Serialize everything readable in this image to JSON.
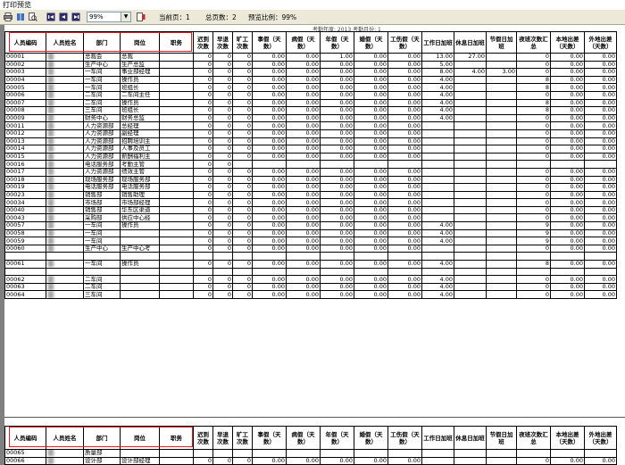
{
  "window": {
    "title": "打印预览"
  },
  "toolbar": {
    "zoom_value": "99%",
    "current_page_label": "当前页：1",
    "total_pages_label": "总页数：2",
    "preview_ratio_label": "预览比例：99%"
  },
  "report": {
    "top_strip": "考勤年度: 2013        考勤月份: 1",
    "headers": [
      "人员编码",
      "人员姓名",
      "部门",
      "岗位",
      "职务",
      "迟到次数",
      "早退次数",
      "旷工次数",
      "事假（天数）",
      "病假（天数）",
      "年假（天数）",
      "婚假（天数）",
      "工伤假（天数）",
      "工作日加班",
      "休息日加班",
      "节假日加班",
      "夜班次数汇总",
      "本地出差（天数）",
      "外地出差（天数）"
    ],
    "rows": [
      [
        "00001",
        "",
        "总裁会",
        "总裁",
        "",
        "0",
        "0",
        "0",
        "0.00",
        "0.00",
        "1.00",
        "0.00",
        "0.00",
        "13.00",
        "27.00",
        "",
        "0",
        "0.00",
        "0.00"
      ],
      [
        "00002",
        "",
        "生产中心",
        "生产总监",
        "",
        "0",
        "0",
        "0",
        "0.00",
        "0.00",
        "0.00",
        "0.00",
        "0.00",
        "5.00",
        "",
        "",
        "0",
        "0.00",
        "0.00"
      ],
      [
        "00003",
        "",
        "一车间",
        "事业部经理",
        "",
        "0",
        "0",
        "0",
        "0.00",
        "0.00",
        "0.00",
        "0.00",
        "0.00",
        "8.00",
        "4.00",
        "3.00",
        "0",
        "0.00",
        "0.00"
      ],
      [
        "00004",
        "",
        "一车间",
        "操作员",
        "",
        "0",
        "0",
        "0",
        "0.00",
        "0.00",
        "0.00",
        "0.00",
        "0.00",
        "4.00",
        "",
        "",
        "8",
        "0.00",
        "0.00"
      ],
      [
        "00005",
        "",
        "一车间",
        "班组长",
        "",
        "0",
        "0",
        "0",
        "0.00",
        "0.00",
        "0.00",
        "0.00",
        "0.00",
        "4.00",
        "",
        "",
        "8",
        "0.00",
        "0.00"
      ],
      [
        "00006",
        "",
        "二车间",
        "二车间主任",
        "",
        "0",
        "0",
        "0",
        "0.00",
        "0.00",
        "0.00",
        "0.00",
        "0.00",
        "4.00",
        "",
        "",
        "0",
        "0.00",
        "0.00"
      ],
      [
        "00007",
        "",
        "二车间",
        "操作员",
        "",
        "0",
        "0",
        "0",
        "0.00",
        "0.00",
        "0.00",
        "0.00",
        "0.00",
        "4.00",
        "",
        "",
        "8",
        "0.00",
        "0.00"
      ],
      [
        "00008",
        "",
        "三车间",
        "班组长",
        "",
        "0",
        "0",
        "0",
        "0.00",
        "0.00",
        "0.00",
        "0.00",
        "0.00",
        "4.00",
        "",
        "",
        "8",
        "0.00",
        "0.00"
      ],
      [
        "00009",
        "",
        "财务中心",
        "财务总监",
        "",
        "0",
        "0",
        "0",
        "0.00",
        "0.00",
        "0.00",
        "0.00",
        "0.00",
        "4.00",
        "",
        "",
        "0",
        "0.00",
        "0.00"
      ],
      [
        "00011",
        "",
        "人力资源部",
        "总经理",
        "",
        "0",
        "0",
        "0",
        "0.00",
        "0.00",
        "0.00",
        "0.00",
        "0.00",
        "",
        "",
        "",
        "0",
        "0.00",
        "0.00"
      ],
      [
        "00012",
        "",
        "人力资源部",
        "副经理",
        "",
        "0",
        "0",
        "0",
        "0.00",
        "0.00",
        "0.00",
        "0.00",
        "0.00",
        "",
        "",
        "",
        "0",
        "0.00",
        "0.00"
      ],
      [
        "00013",
        "",
        "人力资源部",
        "招聘培训主",
        "",
        "0",
        "0",
        "0",
        "0.00",
        "0.00",
        "0.00",
        "0.00",
        "0.00",
        "",
        "",
        "",
        "0",
        "0.00",
        "0.00"
      ],
      [
        "00014",
        "",
        "人力资源部",
        "人事及员工",
        "",
        "0",
        "0",
        "0",
        "0.00",
        "0.00",
        "0.00",
        "0.00",
        "0.00",
        "",
        "",
        "",
        "0",
        "0.00",
        "0.00"
      ],
      [
        "00015",
        "",
        "人力资源部",
        "薪酬福利主",
        "",
        "0",
        "0",
        "0",
        "0.00",
        "0.00",
        "0.00",
        "0.00",
        "0.00",
        "",
        "",
        "",
        "0",
        "0.00",
        "0.00"
      ],
      [
        "00016",
        "",
        "电话服务部",
        "考勤主管",
        "",
        "0",
        "0",
        "",
        "",
        "",
        "",
        "",
        "",
        "",
        "",
        "",
        "",
        "",
        ""
      ],
      [
        "00017",
        "",
        "人力资源部",
        "绩效主管",
        "",
        "0",
        "0",
        "0",
        "0.00",
        "0.00",
        "0.00",
        "0.00",
        "0.00",
        "",
        "",
        "",
        "0",
        "0.00",
        "0.00"
      ],
      [
        "00018",
        "",
        "现场服务部",
        "现场服务部",
        "",
        "0",
        "0",
        "0",
        "0.00",
        "0.00",
        "0.00",
        "0.00",
        "0.00",
        "",
        "",
        "",
        "0",
        "0.00",
        "0.00"
      ],
      [
        "00019",
        "",
        "电话服务部",
        "电话服务部",
        "",
        "0",
        "0",
        "0",
        "0.00",
        "0.00",
        "0.00",
        "0.00",
        "0.00",
        "",
        "",
        "",
        "0",
        "0.00",
        "0.00"
      ],
      [
        "00023",
        "",
        "销售部",
        "销售助理",
        "",
        "0",
        "0",
        "0",
        "0.00",
        "0.00",
        "0.00",
        "0.00",
        "0.00",
        "",
        "",
        "",
        "0",
        "0.00",
        "0.00"
      ],
      [
        "00034",
        "",
        "市场部",
        "市场部经理",
        "",
        "0",
        "0",
        "0",
        "0.00",
        "0.00",
        "0.00",
        "0.00",
        "0.00",
        "",
        "",
        "",
        "0",
        "0.00",
        "0.00"
      ],
      [
        "00040",
        "",
        "销售部",
        "华东区渠道",
        "",
        "0",
        "0",
        "0",
        "0.00",
        "0.00",
        "0.00",
        "0.00",
        "0.00",
        "",
        "",
        "",
        "0",
        "0.00",
        "0.00"
      ],
      [
        "00043",
        "",
        "采购部",
        "供应中心经",
        "",
        "0",
        "0",
        "0",
        "0.00",
        "0.00",
        "0.00",
        "0.00",
        "0.00",
        "",
        "",
        "",
        "0",
        "0.00",
        "0.00"
      ],
      [
        "00057",
        "",
        "一车间",
        "操作员",
        "",
        "0",
        "0",
        "0",
        "0.00",
        "0.00",
        "0.00",
        "0.00",
        "0.00",
        "4.00",
        "",
        "",
        "9",
        "0.00",
        "0.00"
      ],
      [
        "00058",
        "",
        "一车间",
        "",
        "",
        "0",
        "0",
        "0",
        "0.00",
        "0.00",
        "0.00",
        "0.00",
        "0.00",
        "4.00",
        "",
        "",
        "9",
        "0.00",
        "0.00"
      ],
      [
        "00059",
        "",
        "一车间",
        "",
        "",
        "0",
        "0",
        "0",
        "0.00",
        "0.00",
        "0.00",
        "0.00",
        "0.00",
        "4.00",
        "",
        "",
        "9",
        "0.00",
        "0.00"
      ],
      [
        "00060",
        "",
        "生产中心",
        "生产中心考",
        "",
        "0",
        "0",
        "0",
        "0.00",
        "0.00",
        "0.00",
        "0.00",
        "0.00",
        "",
        "",
        "",
        "0",
        "0.00",
        "0.00"
      ],
      [
        "",
        "",
        "",
        "",
        "",
        "",
        "",
        "",
        "",
        "",
        "",
        "",
        "",
        "",
        "",
        "",
        "",
        "",
        ""
      ],
      [
        "00061",
        "",
        "一车间",
        "操作员",
        "",
        "0",
        "0",
        "0",
        "0.00",
        "0.00",
        "0.00",
        "0.00",
        "0.00",
        "4.00",
        "",
        "",
        "8",
        "0.00",
        "0.00"
      ],
      [
        "",
        "",
        "",
        "",
        "",
        "",
        "",
        "",
        "",
        "",
        "",
        "",
        "",
        "",
        "",
        "",
        "",
        "",
        ""
      ],
      [
        "00062",
        "",
        "二车间",
        "",
        "",
        "0",
        "0",
        "0",
        "0.00",
        "0.00",
        "0.00",
        "0.00",
        "0.00",
        "4.00",
        "",
        "",
        "0",
        "0.00",
        "0.00"
      ],
      [
        "00063",
        "",
        "二车间",
        "",
        "",
        "0",
        "0",
        "0",
        "0.00",
        "0.00",
        "0.00",
        "0.00",
        "0.00",
        "4.00",
        "",
        "",
        "0",
        "0.00",
        "0.00"
      ],
      [
        "00064",
        "",
        "三车间",
        "",
        "",
        "0",
        "0",
        "0",
        "0.00",
        "0.00",
        "0.00",
        "0.00",
        "0.00",
        "4.00",
        "",
        "",
        "0",
        "0.00",
        "0.00"
      ]
    ],
    "page2_rows": [
      [
        "00065",
        "",
        "质量部",
        "",
        "",
        "",
        "",
        "",
        "",
        "",
        "",
        "",
        "",
        "",
        "",
        "",
        "",
        "",
        ""
      ],
      [
        "00066",
        "",
        "设计部",
        "设计部经理",
        "",
        "0",
        "0",
        "0",
        "0.00",
        "0.00",
        "0.00",
        "0.00",
        "0.00",
        "",
        "",
        "",
        "0",
        "0.00",
        "0.00"
      ]
    ]
  }
}
